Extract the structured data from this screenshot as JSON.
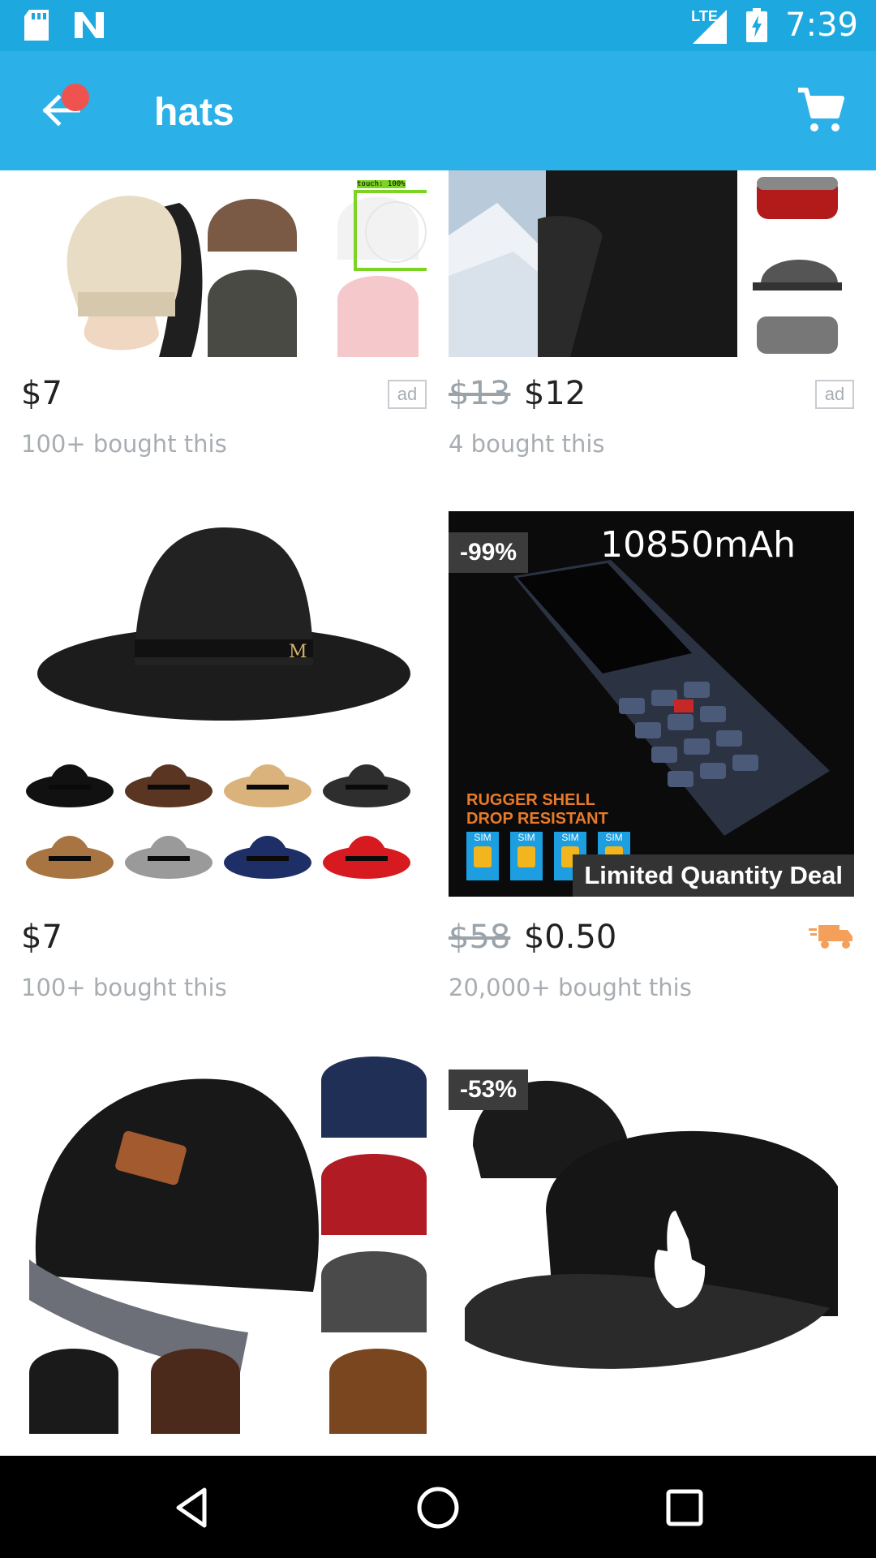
{
  "status_bar": {
    "time": "7:39",
    "network": "LTE",
    "icons": [
      "sd-card-icon",
      "n-icon",
      "signal-icon",
      "battery-charging-icon"
    ]
  },
  "app_bar": {
    "title": "hats",
    "icons": [
      "back-arrow-icon",
      "cart-icon"
    ],
    "notification_color": "#ef5350",
    "bg_color": "#2cb0e8"
  },
  "touch_overlay": {
    "label": "touch: 100%"
  },
  "products": [
    {
      "current_price": "$7",
      "old_price": "",
      "bought": "100+ bought this",
      "badge": "ad",
      "image": "beanie-hats-photo"
    },
    {
      "current_price": "$12",
      "old_price": "$13",
      "bought": "4 bought this",
      "badge": "ad",
      "image": "neck-warmer-photo"
    },
    {
      "current_price": "$7",
      "old_price": "",
      "bought": "100+ bought this",
      "badge": "",
      "image": "fedora-hats-photo"
    },
    {
      "current_price": "$0.50",
      "old_price": "$58",
      "bought": "20,000+ bought this",
      "discount": "-99%",
      "banner": "Limited Quantity Deal",
      "shipping_icon": "truck-icon",
      "image": "rugged-phone-photo",
      "image_text": {
        "capacity": "10850mAh",
        "line1": "RUGGER SHELL",
        "line2": "DROP RESISTANT",
        "sim": "SIM"
      }
    },
    {
      "current_price": "",
      "old_price": "",
      "bought": "",
      "image": "winter-beanies-photo"
    },
    {
      "current_price": "",
      "old_price": "",
      "bought": "",
      "discount": "-53%",
      "image": "snapback-cap-photo"
    }
  ],
  "nav_bar": {
    "icons": [
      "back-triangle-icon",
      "home-circle-icon",
      "recents-square-icon"
    ]
  }
}
